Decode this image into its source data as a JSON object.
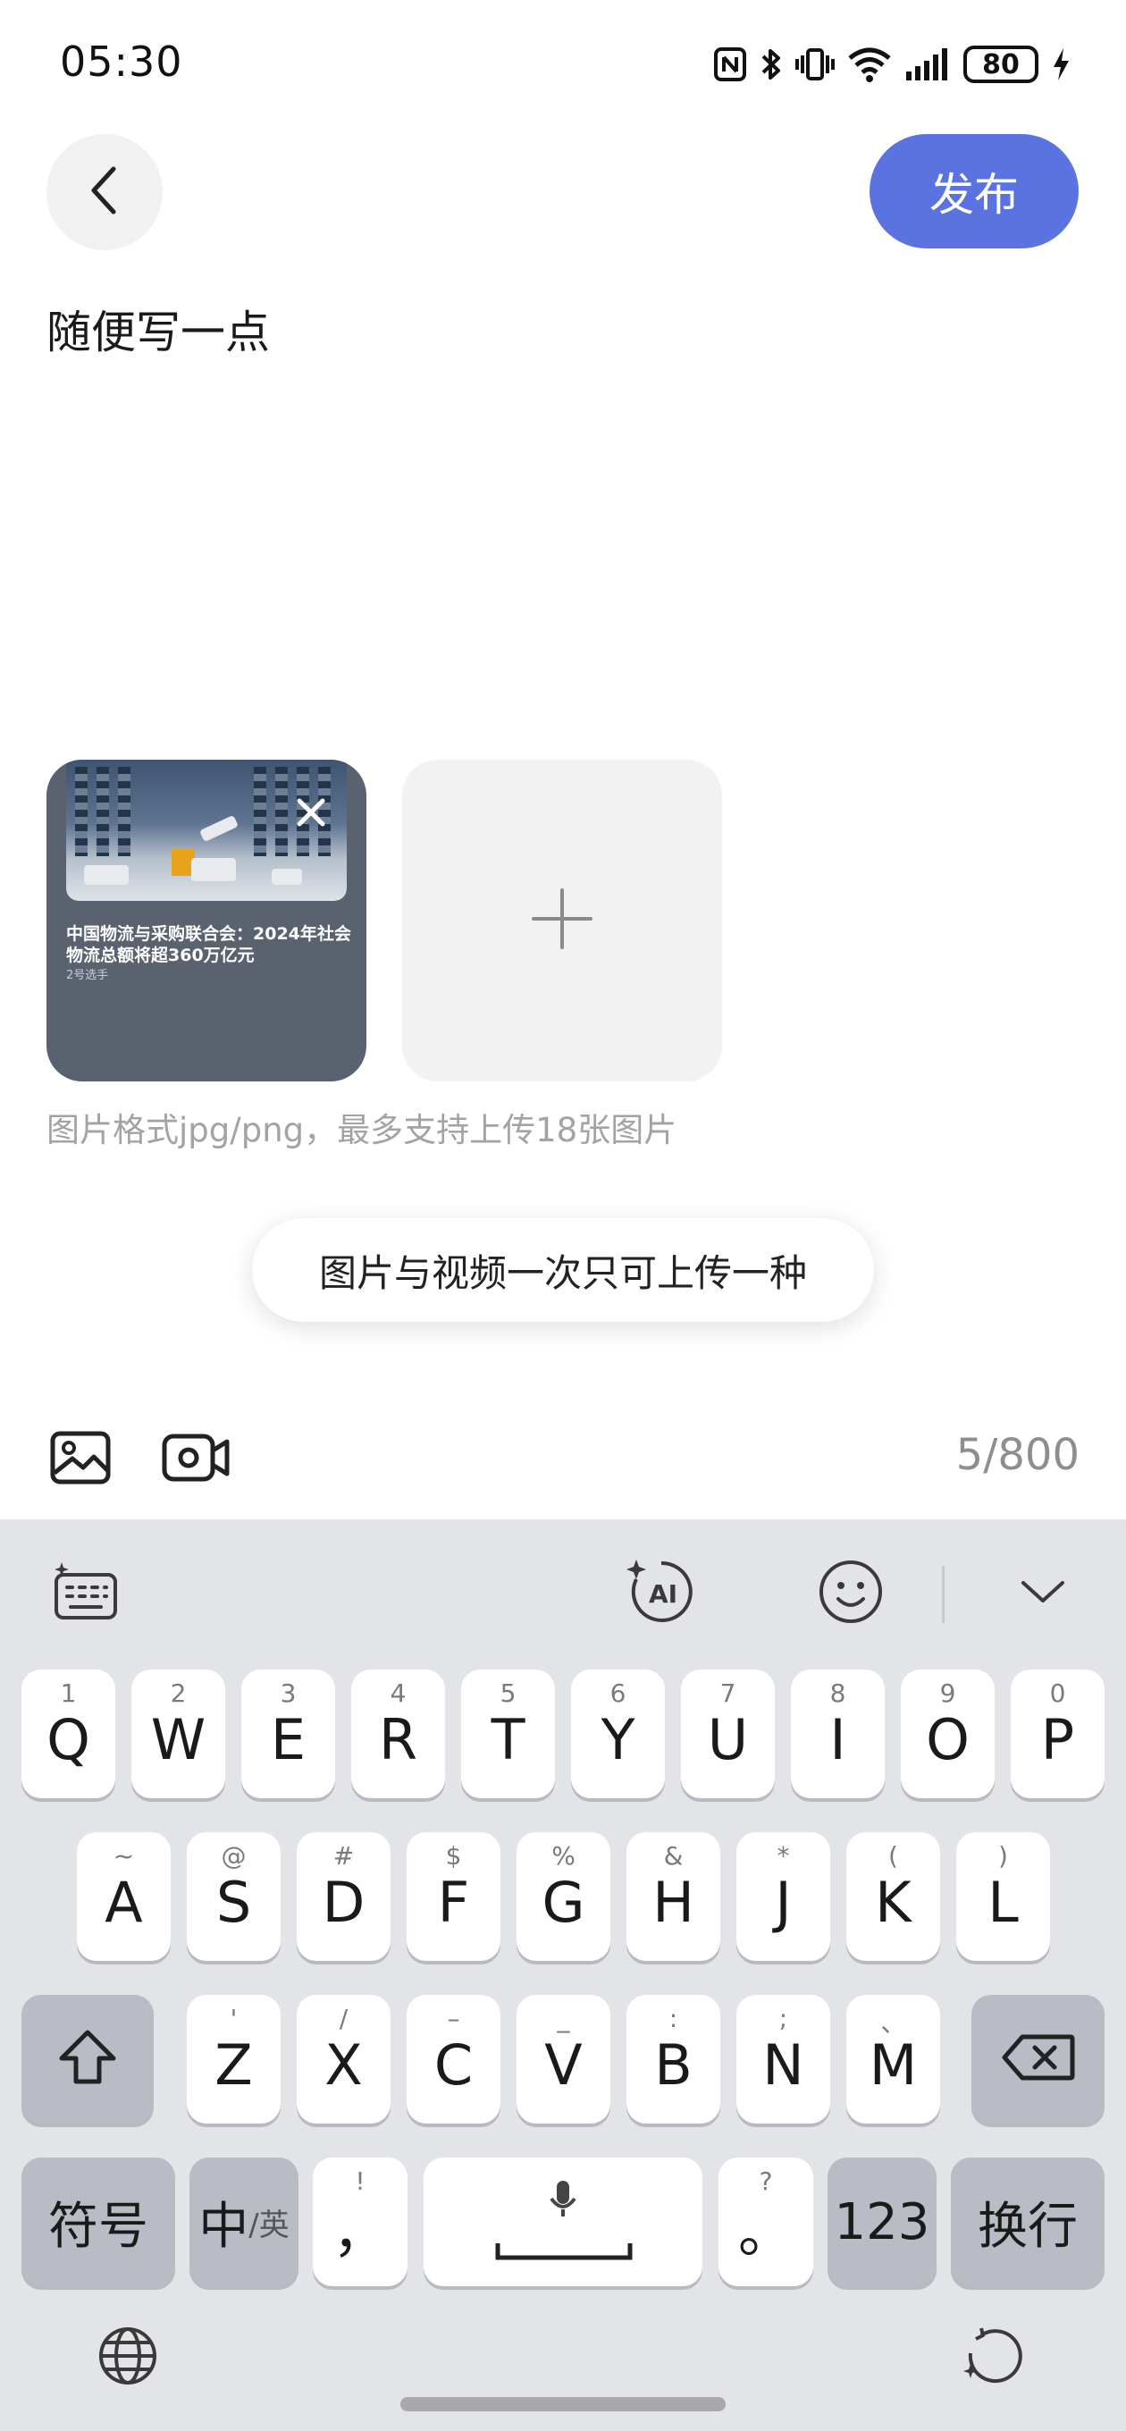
{
  "status_bar": {
    "time": "05:30",
    "battery": "80",
    "icons": [
      "nfc-icon",
      "bluetooth-icon",
      "vibrate-icon",
      "wifi-icon",
      "signal-icon",
      "battery-icon",
      "charging-icon"
    ]
  },
  "header": {
    "back_icon": "chevron-left-icon",
    "publish_label": "发布"
  },
  "editor": {
    "placeholder": "随便写一点"
  },
  "images": {
    "thumb_title": "中国物流与采购联合会：2024年社会物流总额将超360万亿元",
    "thumb_source": "2号选手",
    "add_icon": "plus-icon",
    "hint": "图片格式jpg/png，最多支持上传18张图片"
  },
  "toast": "图片与视频一次只可上传一种",
  "toolbar": {
    "image_icon": "image-icon",
    "video_icon": "video-camera-icon",
    "char_count": "5/800"
  },
  "keyboard": {
    "toolbar_icons": [
      "keyboard-settings-icon",
      "ai-icon",
      "emoji-icon",
      "collapse-keyboard-icon"
    ],
    "row1": [
      {
        "main": "Q",
        "sub": "1"
      },
      {
        "main": "W",
        "sub": "2"
      },
      {
        "main": "E",
        "sub": "3"
      },
      {
        "main": "R",
        "sub": "4"
      },
      {
        "main": "T",
        "sub": "5"
      },
      {
        "main": "Y",
        "sub": "6"
      },
      {
        "main": "U",
        "sub": "7"
      },
      {
        "main": "I",
        "sub": "8"
      },
      {
        "main": "O",
        "sub": "9"
      },
      {
        "main": "P",
        "sub": "0"
      }
    ],
    "row2": [
      {
        "main": "A",
        "sub": "~"
      },
      {
        "main": "S",
        "sub": "@"
      },
      {
        "main": "D",
        "sub": "#"
      },
      {
        "main": "F",
        "sub": "$"
      },
      {
        "main": "G",
        "sub": "%"
      },
      {
        "main": "H",
        "sub": "&"
      },
      {
        "main": "J",
        "sub": "*"
      },
      {
        "main": "K",
        "sub": "("
      },
      {
        "main": "L",
        "sub": ")"
      }
    ],
    "row3": [
      {
        "main": "Z",
        "sub": "'"
      },
      {
        "main": "X",
        "sub": "/"
      },
      {
        "main": "C",
        "sub": "–"
      },
      {
        "main": "V",
        "sub": "_"
      },
      {
        "main": "B",
        "sub": ":"
      },
      {
        "main": "N",
        "sub": ";"
      },
      {
        "main": "M",
        "sub": "、"
      }
    ],
    "symbols_label": "符号",
    "lang_main": "中",
    "lang_sub": "/英",
    "comma_main": "，",
    "comma_sub": "!",
    "period_main": "。",
    "period_sub": "?",
    "numbers_label": "123",
    "enter_label": "换行",
    "bottom_icons": [
      "globe-icon",
      "rotate-icon"
    ]
  }
}
